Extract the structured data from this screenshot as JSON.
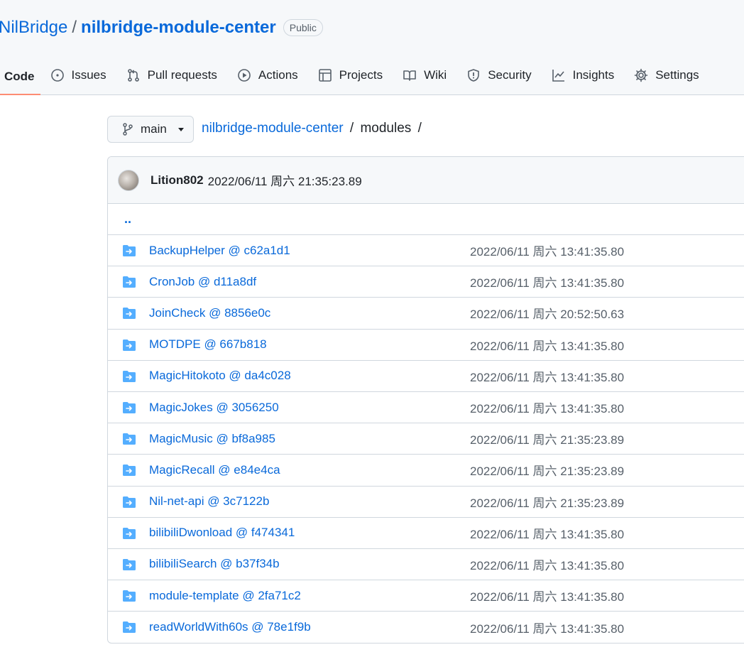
{
  "repo": {
    "owner": "NilBridge",
    "separator": "/",
    "name": "nilbridge-module-center",
    "visibility": "Public"
  },
  "tabs": [
    {
      "label": "Code",
      "icon": "code-icon",
      "selected": true
    },
    {
      "label": "Issues",
      "icon": "issue-opened-icon"
    },
    {
      "label": "Pull requests",
      "icon": "git-pull-request-icon"
    },
    {
      "label": "Actions",
      "icon": "play-icon"
    },
    {
      "label": "Projects",
      "icon": "table-icon"
    },
    {
      "label": "Wiki",
      "icon": "book-icon"
    },
    {
      "label": "Security",
      "icon": "shield-icon"
    },
    {
      "label": "Insights",
      "icon": "graph-icon"
    },
    {
      "label": "Settings",
      "icon": "gear-icon"
    }
  ],
  "branch": {
    "name": "main",
    "icon": "git-branch-icon"
  },
  "breadcrumb": {
    "repo": "nilbridge-module-center",
    "sep1": "/",
    "folder": "modules",
    "sep2": "/"
  },
  "commit": {
    "author": "Lition802",
    "timestamp": "2022/06/11 周六 21:35:23.89"
  },
  "parent_link": "..",
  "files": [
    {
      "name": "BackupHelper @ c62a1d1",
      "date": "2022/06/11 周六 13:41:35.80"
    },
    {
      "name": "CronJob @ d11a8df",
      "date": "2022/06/11 周六 13:41:35.80"
    },
    {
      "name": "JoinCheck @ 8856e0c",
      "date": "2022/06/11 周六 20:52:50.63"
    },
    {
      "name": "MOTDPE @ 667b818",
      "date": "2022/06/11 周六 13:41:35.80"
    },
    {
      "name": "MagicHitokoto @ da4c028",
      "date": "2022/06/11 周六 13:41:35.80"
    },
    {
      "name": "MagicJokes @ 3056250",
      "date": "2022/06/11 周六 13:41:35.80"
    },
    {
      "name": "MagicMusic @ bf8a985",
      "date": "2022/06/11 周六 21:35:23.89"
    },
    {
      "name": "MagicRecall @ e84e4ca",
      "date": "2022/06/11 周六 21:35:23.89"
    },
    {
      "name": "Nil-net-api @ 3c7122b",
      "date": "2022/06/11 周六 21:35:23.89"
    },
    {
      "name": "bilibiliDwonload @ f474341",
      "date": "2022/06/11 周六 13:41:35.80"
    },
    {
      "name": "bilibiliSearch @ b37f34b",
      "date": "2022/06/11 周六 13:41:35.80"
    },
    {
      "name": "module-template @ 2fa71c2",
      "date": "2022/06/11 周六 13:41:35.80"
    },
    {
      "name": "readWorldWith60s @ 78e1f9b",
      "date": "2022/06/11 周六 13:41:35.80"
    }
  ],
  "colors": {
    "link": "#0969da",
    "folder_icon": "#54aeff",
    "selected_tab_underline": "#fd8c73",
    "muted_text": "#57606a"
  }
}
